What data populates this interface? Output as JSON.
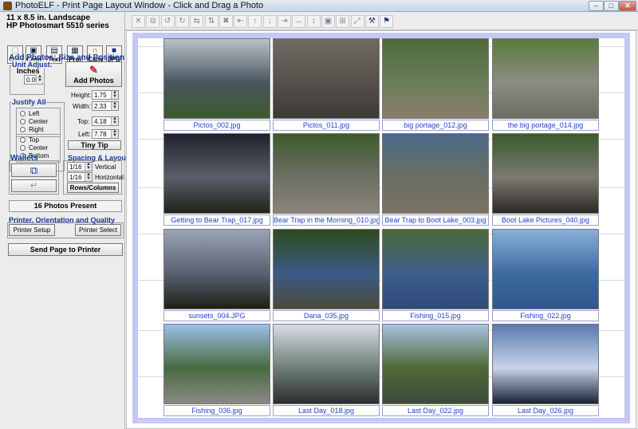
{
  "window": {
    "title": "PhotoELF - Print Page Layout Window - Click and Drag a Photo"
  },
  "page_info": {
    "size": "11 x 8.5 in. Landscape",
    "printer": "HP Photosmart 5510 series"
  },
  "tool_buttons": [
    "Size",
    "Crop",
    "Text",
    "Proj",
    "Canv",
    "JPG"
  ],
  "add_photos": {
    "section_title": "Add Photos: Size and Position",
    "unit_adjust_label": "Unit Adjust:",
    "unit": "Inches",
    "unit_step": "0.05",
    "button": "Add Photos"
  },
  "justify": {
    "title": "Justify All",
    "horizontal": [
      "Left",
      "Center",
      "Right"
    ],
    "vertical": [
      "Top",
      "Center",
      "Bottom"
    ]
  },
  "dimensions": [
    {
      "label": "Height:",
      "value": "1.75"
    },
    {
      "label": "Width:",
      "value": "2.33"
    },
    {
      "label": "Top:",
      "value": "4.18"
    },
    {
      "label": "Left:",
      "value": "7.78"
    }
  ],
  "tiny_tip_button": "Tiny Tip",
  "wallets": {
    "title": "Wallets"
  },
  "spacing": {
    "title": "Spacing & Layout",
    "vertical_value": "1/16",
    "vertical_label": "Vertical",
    "horizontal_value": "1/16",
    "horizontal_label": "Horizontal",
    "button": "Rows/Columns"
  },
  "photos_present": "16 Photos Present",
  "printer": {
    "title": "Printer, Orientation and Quality",
    "setup_button": "Printer Setup",
    "select_button": "Printer Select"
  },
  "send_button": "Send Page to Printer",
  "toolbar_icons": [
    "delete-icon",
    "copy-icon",
    "undo-icon",
    "rotate-icon",
    "flip-horizontal-icon",
    "flip-vertical-icon",
    "shuffle-icon",
    "align-top-edge-icon",
    "align-up-icon",
    "align-down-icon",
    "align-right-edge-icon",
    "space-horizontal-icon",
    "space-vertical-icon",
    "fit-page-icon",
    "grid-icon",
    "expand-icon",
    "tools-icon",
    "exit-icon"
  ],
  "photos": [
    {
      "caption": "Pictos_002.jpg",
      "colors": [
        "#b9c2c8",
        "#4a5660",
        "#3c5a2e"
      ]
    },
    {
      "caption": "Pictos_011.jpg",
      "colors": [
        "#6f6a62",
        "#55504a",
        "#3d3a36"
      ]
    },
    {
      "caption": "big portage_012.jpg",
      "colors": [
        "#4d6a3a",
        "#6a7e5a",
        "#8a7e6e"
      ]
    },
    {
      "caption": "the big portage_014.jpg",
      "colors": [
        "#5a7a3e",
        "#8c8c84",
        "#6c6e60"
      ]
    },
    {
      "caption": "Getting to Bear Trap_017.jpg",
      "colors": [
        "#20222a",
        "#5a5e6a",
        "#202418"
      ]
    },
    {
      "caption": "Bear Trap in the Morning_010.jpg",
      "colors": [
        "#3c5a2a",
        "#6e7066",
        "#8a8478"
      ]
    },
    {
      "caption": "Bear Trap to Boot Lake_003.jpg",
      "colors": [
        "#4a6a8a",
        "#6a6e62",
        "#7a7264"
      ]
    },
    {
      "caption": "Boot Lake Pictures_040.jpg",
      "colors": [
        "#3a5a2e",
        "#7c7a70",
        "#2c2a26"
      ]
    },
    {
      "caption": "sunsets_004.JPG",
      "colors": [
        "#9aa4b4",
        "#5a6272",
        "#1e2018"
      ]
    },
    {
      "caption": "Dana_035.jpg",
      "colors": [
        "#2e4a1e",
        "#3a5a86",
        "#4a4a3e"
      ]
    },
    {
      "caption": "Fishing_015.jpg",
      "colors": [
        "#4c6a3a",
        "#3e5e8c",
        "#2e4a7a"
      ]
    },
    {
      "caption": "Fishing_022.jpg",
      "colors": [
        "#8ab0d8",
        "#3c6aa0",
        "#2e5888"
      ]
    },
    {
      "caption": "Fishing_036.jpg",
      "colors": [
        "#9ac0e8",
        "#4a6a40",
        "#8a8a86"
      ]
    },
    {
      "caption": "Last Day_018.jpg",
      "colors": [
        "#d8dce4",
        "#6e7e76",
        "#2a2e30"
      ]
    },
    {
      "caption": "Last Day_022.jpg",
      "colors": [
        "#a8c4e0",
        "#4e6a36",
        "#3e4a3a"
      ]
    },
    {
      "caption": "Last Day_026.jpg",
      "colors": [
        "#5a7ab0",
        "#c8d4e8",
        "#1a2236"
      ]
    }
  ]
}
